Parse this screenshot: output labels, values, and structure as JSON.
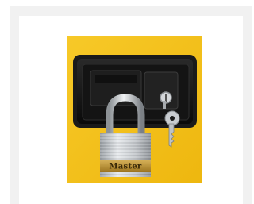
{
  "image": {
    "subject": "padlock-on-latch-icon",
    "padlock_brand": "Master",
    "colors": {
      "cabinet": "#f4c21a",
      "latch": "#121212",
      "padlock_body": "#c9cdd1",
      "brass_band": "#b48a2c",
      "key": "#bfc3c6"
    }
  }
}
